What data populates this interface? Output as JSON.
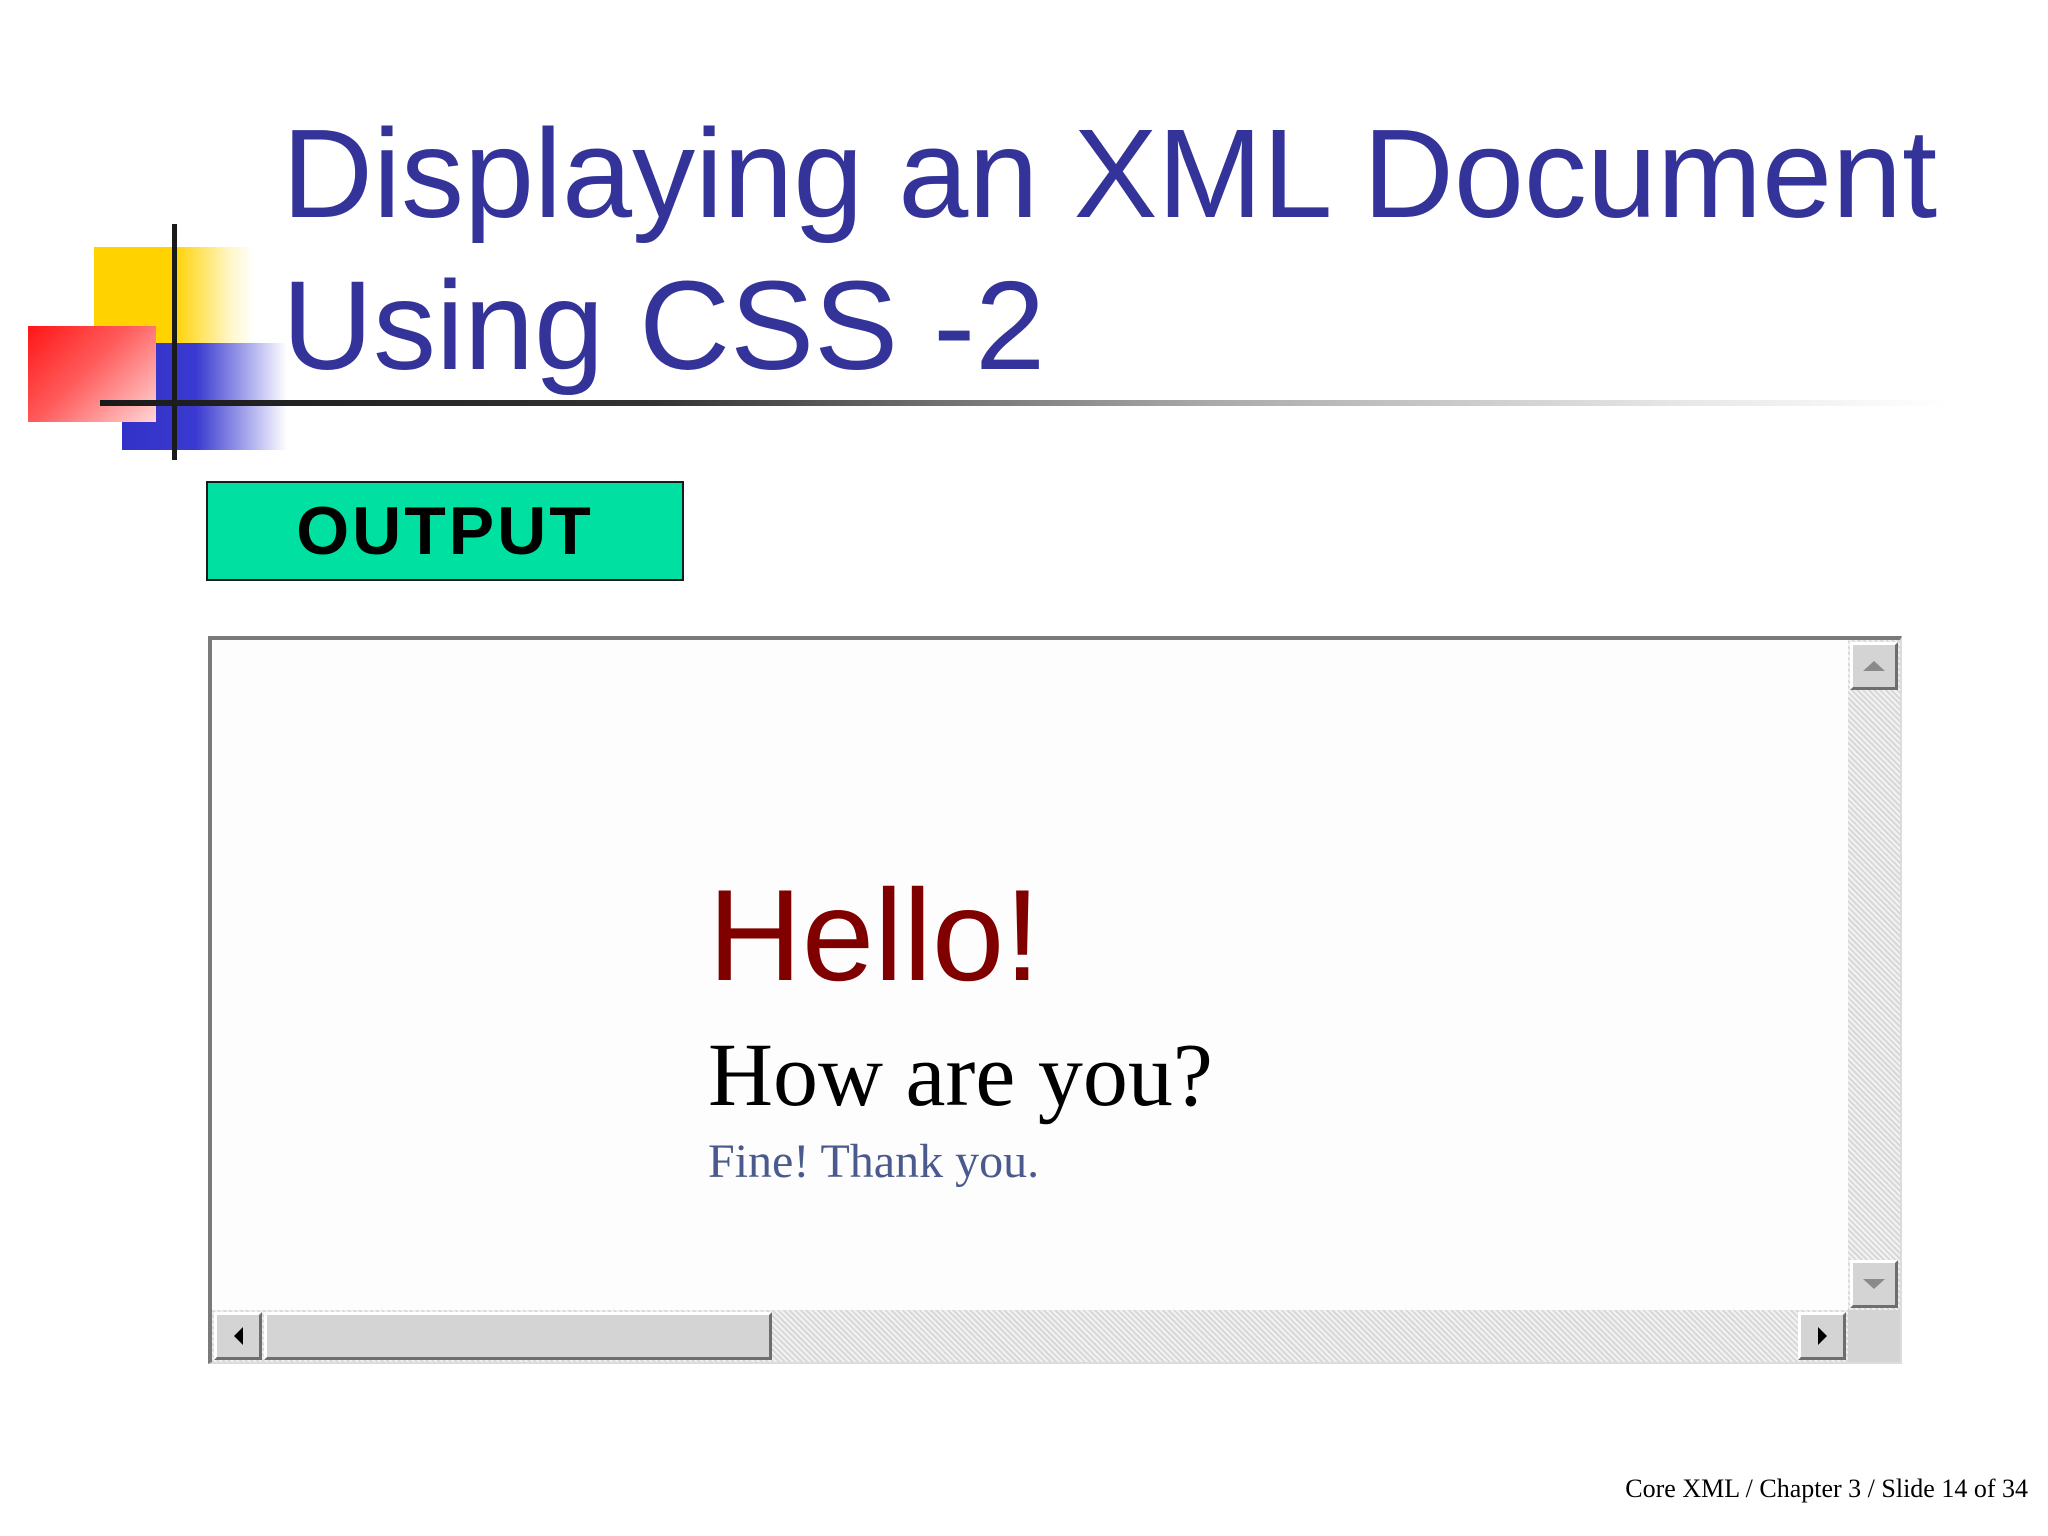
{
  "slide": {
    "title_lines": [
      "Displaying an XML Document",
      "Using CSS -2"
    ],
    "badge": "OUTPUT",
    "footer": "Core XML / Chapter 3 / Slide 14 of 34"
  },
  "browser": {
    "hello": "Hello!",
    "how": "How are you?",
    "fine": "Fine! Thank you."
  },
  "colors": {
    "title": "#333399",
    "badge_bg": "#00e0a0",
    "hello": "#800000",
    "how": "#000000",
    "fine": "#4a5a8c"
  },
  "icons": {
    "scroll_up": "arrow-up-icon",
    "scroll_down": "arrow-down-icon",
    "scroll_left": "arrow-left-icon",
    "scroll_right": "arrow-right-icon"
  }
}
